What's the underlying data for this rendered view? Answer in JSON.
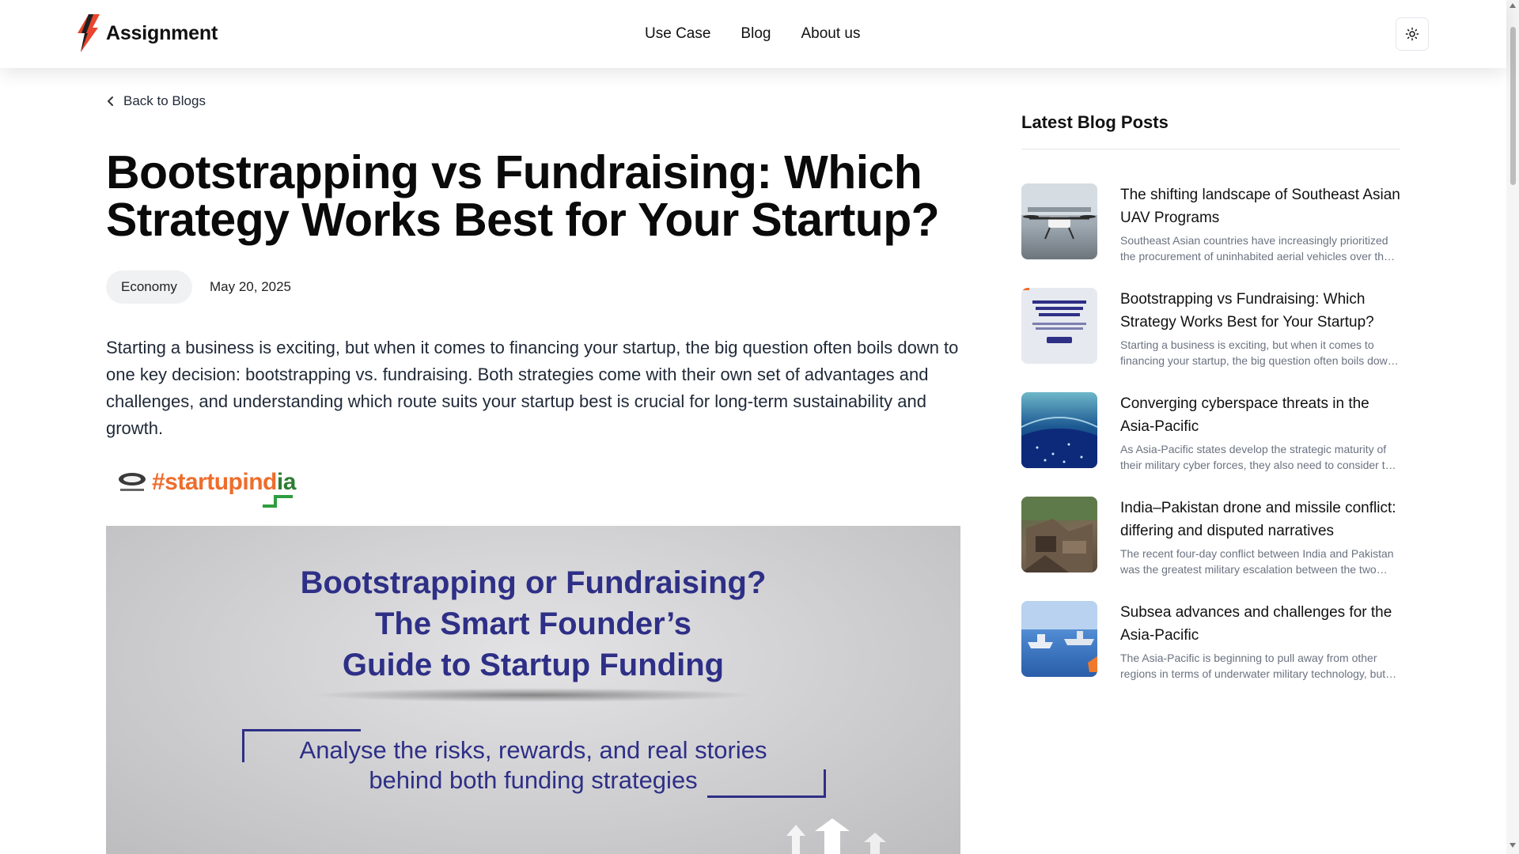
{
  "header": {
    "brand": "Assignment",
    "nav": [
      "Use Case",
      "Blog",
      "About us"
    ],
    "theme_icon": "sun-icon"
  },
  "article": {
    "back_label": "Back to Blogs",
    "title": "Bootstrapping vs Fundraising: Which Strategy Works Best for Your Startup?",
    "tag": "Economy",
    "date": "May 20, 2025",
    "intro": "Starting a business is exciting, but when it comes to financing your startup, the big question often boils down to one key decision: bootstrapping vs. fundraising. Both strategies come with their own set of advantages and challenges, and understanding which route suits your startup best is crucial for long-term sustainability and growth.",
    "image_logo": "#startupindia",
    "image": {
      "title_lines": [
        "Bootstrapping or Fundraising?",
        "The Smart Founder’s",
        "Guide to Startup Funding"
      ],
      "subtitle_lines": [
        "Analyse the risks, rewards, and real stories",
        "behind both funding strategies"
      ]
    }
  },
  "sidebar": {
    "title": "Latest Blog Posts",
    "posts": [
      {
        "title": "The shifting landscape of Southeast Asian UAV Programs",
        "excerpt": "Southeast Asian countries have increasingly prioritized the procurement of uninhabited aerial vehicles over the past decade.",
        "thumb_icon": "drone-photo"
      },
      {
        "title": "Bootstrapping vs Fundraising: Which Strategy Works Best for Your Startup?",
        "excerpt": "Starting a business is exciting, but when it comes to financing your startup, the big question often boils down to one key decision.",
        "thumb_icon": "startup-funding-thumbnail"
      },
      {
        "title": "Converging cyberspace threats in the Asia-Pacific",
        "excerpt": "As Asia-Pacific states develop the strategic maturity of their military cyber forces, they also need to consider the wider threat landscape.",
        "thumb_icon": "cyber-globe-photo"
      },
      {
        "title": "India–Pakistan drone and missile conflict: differing and disputed narratives",
        "excerpt": "The recent four-day conflict between India and Pakistan was the greatest military escalation between the two nuclear-armed states in decades.",
        "thumb_icon": "damaged-building-photo"
      },
      {
        "title": "Subsea advances and challenges for the Asia-Pacific",
        "excerpt": "The Asia-Pacific is beginning to pull away from other regions in terms of underwater military technology, but challenges remain.",
        "thumb_icon": "naval-ships-photo"
      }
    ]
  }
}
